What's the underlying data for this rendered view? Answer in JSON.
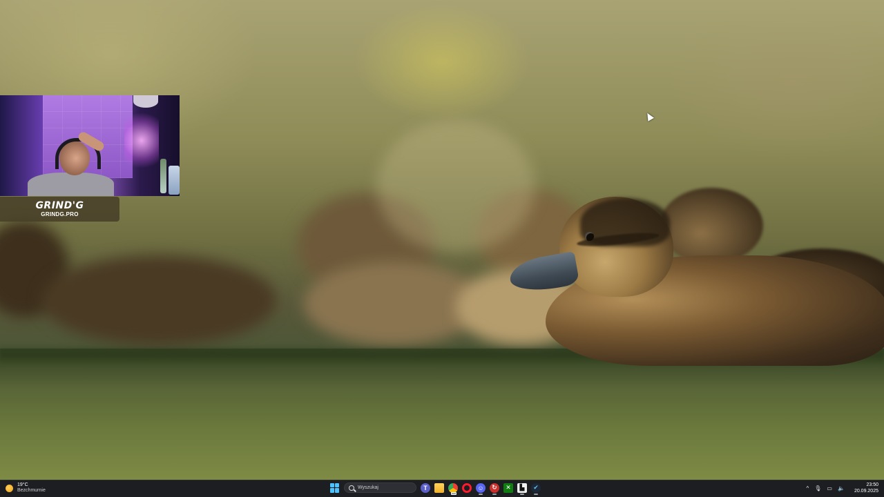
{
  "overlay": {
    "brand_logo": "GRIND'G",
    "brand_url": "GRINDG.PRO"
  },
  "taskbar": {
    "weather": {
      "temperature": "19°C",
      "condition": "Bezchmurnie",
      "icon": "sun-icon"
    },
    "search": {
      "placeholder": "Wyszukaj"
    },
    "pinned_apps": [
      {
        "name": "teams-icon",
        "glyph": "T"
      },
      {
        "name": "file-explorer-icon",
        "glyph": ""
      },
      {
        "name": "chrome-icon",
        "glyph": ""
      },
      {
        "name": "opera-icon",
        "glyph": ""
      },
      {
        "name": "discord-icon",
        "glyph": "☺"
      },
      {
        "name": "red-app-icon",
        "glyph": "↻"
      },
      {
        "name": "xbox-app-icon",
        "glyph": "✕"
      },
      {
        "name": "white-app-icon",
        "glyph": "▙"
      },
      {
        "name": "steam-icon",
        "glyph": "✔"
      }
    ],
    "tray": {
      "chevron": "^",
      "mic": "🎙",
      "network": "▭",
      "volume": "🔈"
    },
    "clock": {
      "time": "23:50",
      "date": "20.09.2025"
    }
  },
  "colors": {
    "taskbar_bg": "#1d1e22",
    "windows_accent": "#4cc2ff"
  }
}
